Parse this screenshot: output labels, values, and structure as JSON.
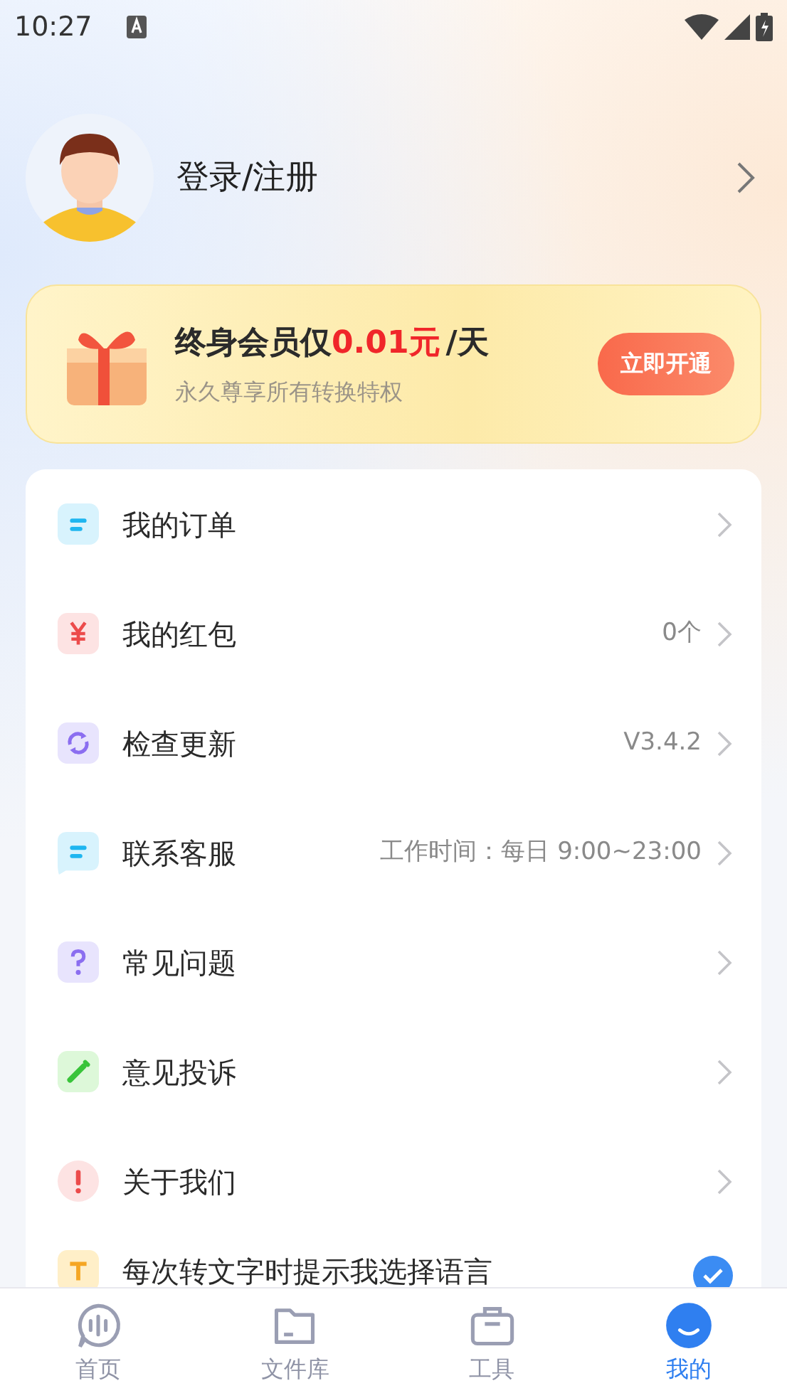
{
  "status_bar": {
    "time": "10:27"
  },
  "profile": {
    "login_label": "登录/注册"
  },
  "vip_banner": {
    "title_lead": "终身会员仅",
    "price": "0.01元",
    "title_tail": "/天",
    "subtitle": "永久尊享所有转换特权",
    "button": "立即开通"
  },
  "menu": [
    {
      "kind": "link",
      "label": "我的订单"
    },
    {
      "kind": "link",
      "label": "我的红包",
      "value": "0个"
    },
    {
      "kind": "link",
      "label": "检查更新",
      "value": "V3.4.2"
    },
    {
      "kind": "link",
      "label": "联系客服",
      "value": "工作时间：每日 9:00~23:00"
    },
    {
      "kind": "link",
      "label": "常见问题"
    },
    {
      "kind": "link",
      "label": "意见投诉"
    },
    {
      "kind": "link",
      "label": "关于我们"
    },
    {
      "kind": "toggle",
      "label": "每次转文字时提示我选择语言",
      "checked": true
    }
  ],
  "tab_bar": [
    {
      "label": "首页",
      "selected": false
    },
    {
      "label": "文件库",
      "selected": false
    },
    {
      "label": "工具",
      "selected": false
    },
    {
      "label": "我的",
      "selected": true
    }
  ]
}
